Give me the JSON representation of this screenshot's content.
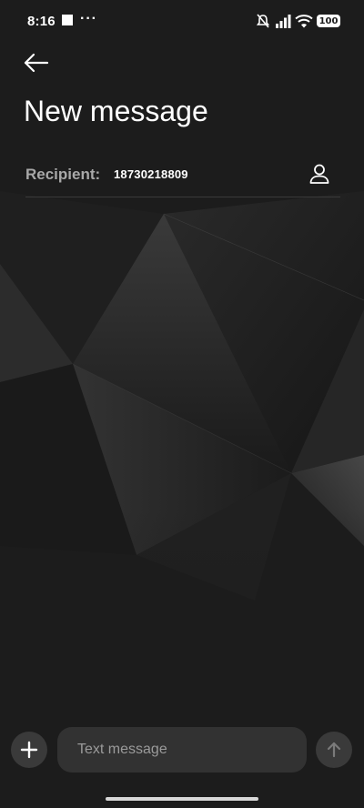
{
  "status_bar": {
    "time": "8:16",
    "more_indicator": "···",
    "battery": "100",
    "icons": [
      "image-notification-icon",
      "mute-vibrate-icon",
      "signal-icon",
      "wifi-icon",
      "battery-icon"
    ]
  },
  "header": {
    "back_icon": "arrow-left-icon",
    "title": "New message"
  },
  "recipient": {
    "label": "Recipient:",
    "value": "18730218809",
    "contact_icon": "person-icon"
  },
  "composer": {
    "add_icon": "plus-icon",
    "placeholder": "Text message",
    "value": "",
    "send_icon": "arrow-up-icon"
  },
  "colors": {
    "background": "#1c1c1c",
    "field": "#323232",
    "button": "#3a3a3a",
    "label": "#a8a8a8",
    "send_icon": "#7a7a7a"
  }
}
